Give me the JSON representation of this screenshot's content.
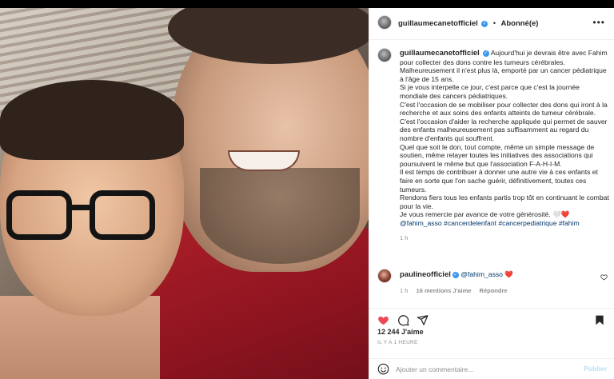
{
  "post": {
    "author": "guillaumecanetofficiel",
    "follow_status": "Abonné(e)",
    "caption_lines": [
      "Aujourd'hui je devrais être avec Fahim pour collecter des dons contre les tumeurs cérébrales. Malheureusement il n'est plus là, emporté par un cancer pédiatrique à l'âge de 15 ans.",
      "Si je vous interpelle ce jour, c'est parce que c'est la journée mondiale des cancers pédiatriques.",
      "C'est l'occasion de se mobiliser pour collecter des dons qui iront à la recherche et aux soins des enfants atteints de tumeur cérébrale.",
      "C'est l'occasion d'aider la recherche appliquée qui permet de sauver des enfants malheureusement pas suffisamment au regard du nombre d'enfants qui souffrent.",
      "Quel que soit le don, tout compte, même un simple message de soutien, même relayer toutes les initiatives des associations qui poursuivent le même but que l'association F-A-H-I-M.",
      "Il est temps de contribuer à donner une autre vie à ces enfants et faire en sorte que l'on sache guérir, définitivement, toutes ces tumeurs.",
      "Rendons fiers tous les enfants partis trop tôt en continuant le combat pour la vie.",
      "Je vous remercie par avance de votre générosité. 🤍❤️"
    ],
    "hashtags": "@fahim_asso #cancerdelenfant #cancerpediatrique #fahim",
    "caption_time": "1 h",
    "likes": "12 244 J'aime",
    "time_ago": "IL Y A 1 HEURE"
  },
  "comment": {
    "author": "paulineofficiel",
    "mention": "@fahim_asso",
    "heart": "❤️",
    "time": "1 h",
    "likes": "16 mentions J'aime",
    "reply": "Répondre"
  },
  "add_comment": {
    "placeholder": "Ajouter un commentaire...",
    "publish": "Publier"
  },
  "icons": {
    "header_more": "more-horizontal-icon",
    "like": "heart-filled-icon",
    "comment": "comment-bubble-icon",
    "share": "paper-plane-icon",
    "save": "bookmark-filled-icon",
    "emoji": "smiley-icon",
    "comment_like": "heart-outline-icon",
    "verified": "verified-badge-icon"
  },
  "colors": {
    "like_red": "#ed4956",
    "verified_blue": "#3897f0",
    "link_blue": "#00376b"
  }
}
